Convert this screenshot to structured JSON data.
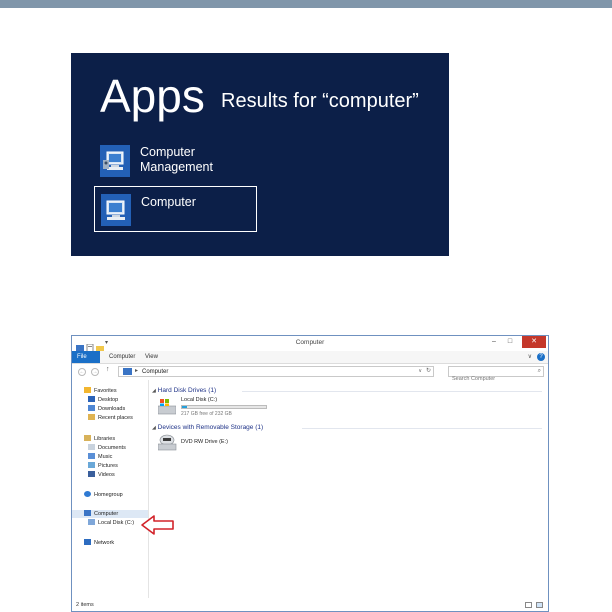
{
  "apps_search": {
    "heading": "Apps",
    "results_text": "Results for “computer”",
    "results": [
      {
        "label_line1": "Computer",
        "label_line2": "Management",
        "icon": "computer-management-icon",
        "selected": false
      },
      {
        "label_line1": "Computer",
        "label_line2": "",
        "icon": "computer-icon",
        "selected": true
      }
    ]
  },
  "explorer": {
    "window_title": "Computer",
    "window_controls": [
      "–",
      "□",
      "✕"
    ],
    "ribbon_tabs": [
      "File",
      "Computer",
      "View"
    ],
    "ribbon_help": "?",
    "ribbon_expand": "∨",
    "nav_buttons": [
      "←",
      "→"
    ],
    "nav_up": "↑",
    "address": {
      "sep": "▸",
      "crumb": "Computer",
      "dropdown": "∨",
      "refresh": "↻"
    },
    "search_placeholder": "Search Computer",
    "search_icon": "⌕",
    "nav_pane": {
      "favorites": {
        "label": "Favorites",
        "items": [
          "Desktop",
          "Downloads",
          "Recent places"
        ]
      },
      "libraries": {
        "label": "Libraries",
        "items": [
          "Documents",
          "Music",
          "Pictures",
          "Videos"
        ]
      },
      "homegroup": "Homegroup",
      "computer": {
        "label": "Computer",
        "items": [
          "Local Disk (C:)"
        ]
      },
      "network": "Network"
    },
    "content": {
      "hard_disk_header": "Hard Disk Drives (1)",
      "local_disk": {
        "name": "Local Disk (C:)",
        "free_text": "217 GB free of 232 GB",
        "used_fraction": 0.065
      },
      "removable_header": "Devices with Removable Storage (1)",
      "dvd_drive": {
        "name": "DVD RW Drive (E:)"
      }
    },
    "status_text": "2 items"
  },
  "colors": {
    "apps_bg": "#0c1f48",
    "tile_blue": "#2360b6",
    "header_band": "#8096aa",
    "explorer_border": "#6f91c0",
    "file_tab": "#1a6fc7",
    "close_button": "#c4372a",
    "drive_bar_fill": "#26a0da",
    "group_header_text": "#1e3287",
    "callout_arrow": "#d2232a"
  }
}
